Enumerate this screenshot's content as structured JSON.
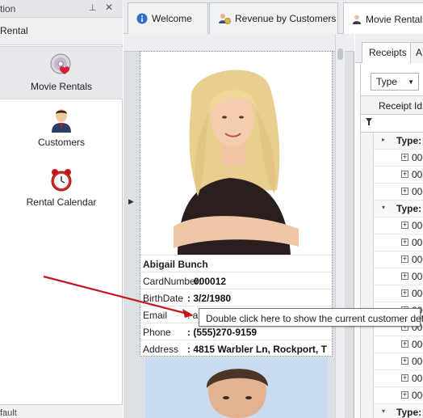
{
  "nav": {
    "title": "tion",
    "group_label": "Rental",
    "items": [
      {
        "label": "Movie Rentals",
        "icon": "movie-disc-icon"
      },
      {
        "label": "Customers",
        "icon": "customer-icon"
      },
      {
        "label": "Rental Calendar",
        "icon": "alarm-clock-icon"
      }
    ],
    "footer": "fault"
  },
  "tabs": [
    {
      "label": "Welcome",
      "icon": "info-icon"
    },
    {
      "label": "Revenue by Customers",
      "icon": "revenue-icon"
    },
    {
      "label": "Movie Rentals",
      "icon": "person-icon"
    }
  ],
  "customer": {
    "name": "Abigail  Bunch",
    "card_label": "CardNumber:",
    "card_value": "000012",
    "birth_label": "BirthDate",
    "birth_value": ": 3/2/1980",
    "email_label": "Email",
    "email_value": ": a",
    "phone_label": "Phone",
    "phone_value": ": (555)270-9159",
    "address_label": "Address",
    "address_value": ": 4815 Warbler Ln,  Rockport, T"
  },
  "tooltip": "Double click here to show the current customer details",
  "grid": {
    "subtabs": [
      "Receipts",
      "A"
    ],
    "type_dropdown": "Type",
    "column_header": "Receipt Id",
    "filter_icon": "filter-icon",
    "rows": [
      {
        "kind": "group",
        "text": "Type:",
        "expander": "▸"
      },
      {
        "kind": "row",
        "text": "000"
      },
      {
        "kind": "row",
        "text": "000"
      },
      {
        "kind": "row",
        "text": "000"
      },
      {
        "kind": "group",
        "text": "Type:",
        "expander": "▾"
      },
      {
        "kind": "row",
        "text": "000"
      },
      {
        "kind": "row",
        "text": "000"
      },
      {
        "kind": "row",
        "text": "000"
      },
      {
        "kind": "row",
        "text": "000"
      },
      {
        "kind": "row",
        "text": "000"
      },
      {
        "kind": "row",
        "text": "000"
      },
      {
        "kind": "row",
        "text": "000"
      },
      {
        "kind": "row",
        "text": "000"
      },
      {
        "kind": "row",
        "text": "000"
      },
      {
        "kind": "row",
        "text": "000"
      },
      {
        "kind": "row",
        "text": "000"
      },
      {
        "kind": "group",
        "text": "Type:",
        "expander": "▾"
      }
    ]
  },
  "colors": {
    "accent_red": "#c0181c",
    "panel_bg": "#e9ebee",
    "photo_bg": "#c7d8ec"
  }
}
